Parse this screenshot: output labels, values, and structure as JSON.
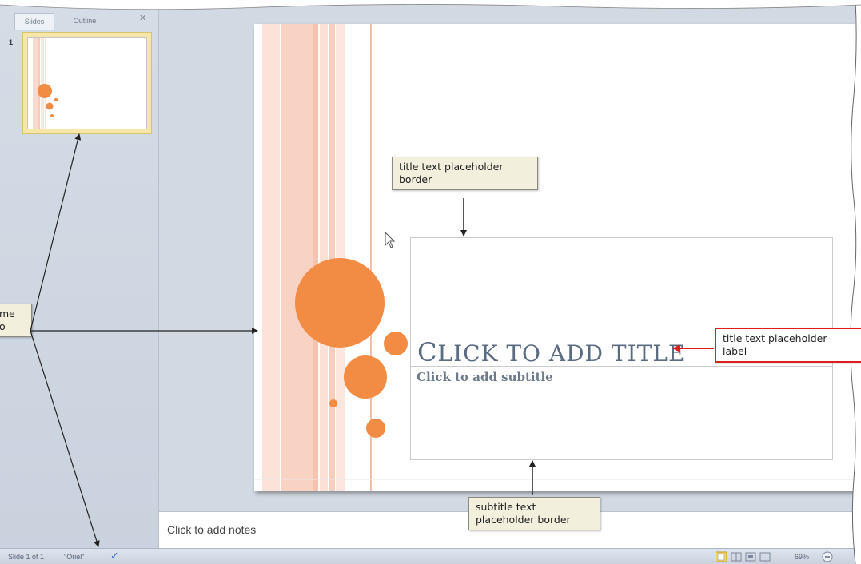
{
  "left_pane": {
    "tab_slides": "Slides",
    "tab_outline": "Outline",
    "close": "✕",
    "thumb_number": "1"
  },
  "slide": {
    "title_placeholder_c": "C",
    "title_placeholder_rest": "LICK TO ADD TITLE",
    "subtitle_placeholder": "Click to add subtitle"
  },
  "notes": {
    "placeholder": "Click to add notes"
  },
  "status_bar": {
    "slide_info": "Slide 1 of 1",
    "theme": "\"Oriel\"",
    "zoom": "69%"
  },
  "callouts": {
    "title_border_line1": "title text placeholder",
    "title_border_line2": "border",
    "title_label_line1": "title text placeholder",
    "title_label_line2": "label",
    "subtitle_border_line1": "subtitle text",
    "subtitle_border_line2": "placeholder border",
    "left_partial_line1": "me",
    "left_partial_line2": "o"
  },
  "colors": {
    "accent_orange": "#f28c45",
    "stripe_pink": "#f6c9b8",
    "callout_red": "#e01c1c",
    "callout_bg": "#f2f0dc"
  }
}
